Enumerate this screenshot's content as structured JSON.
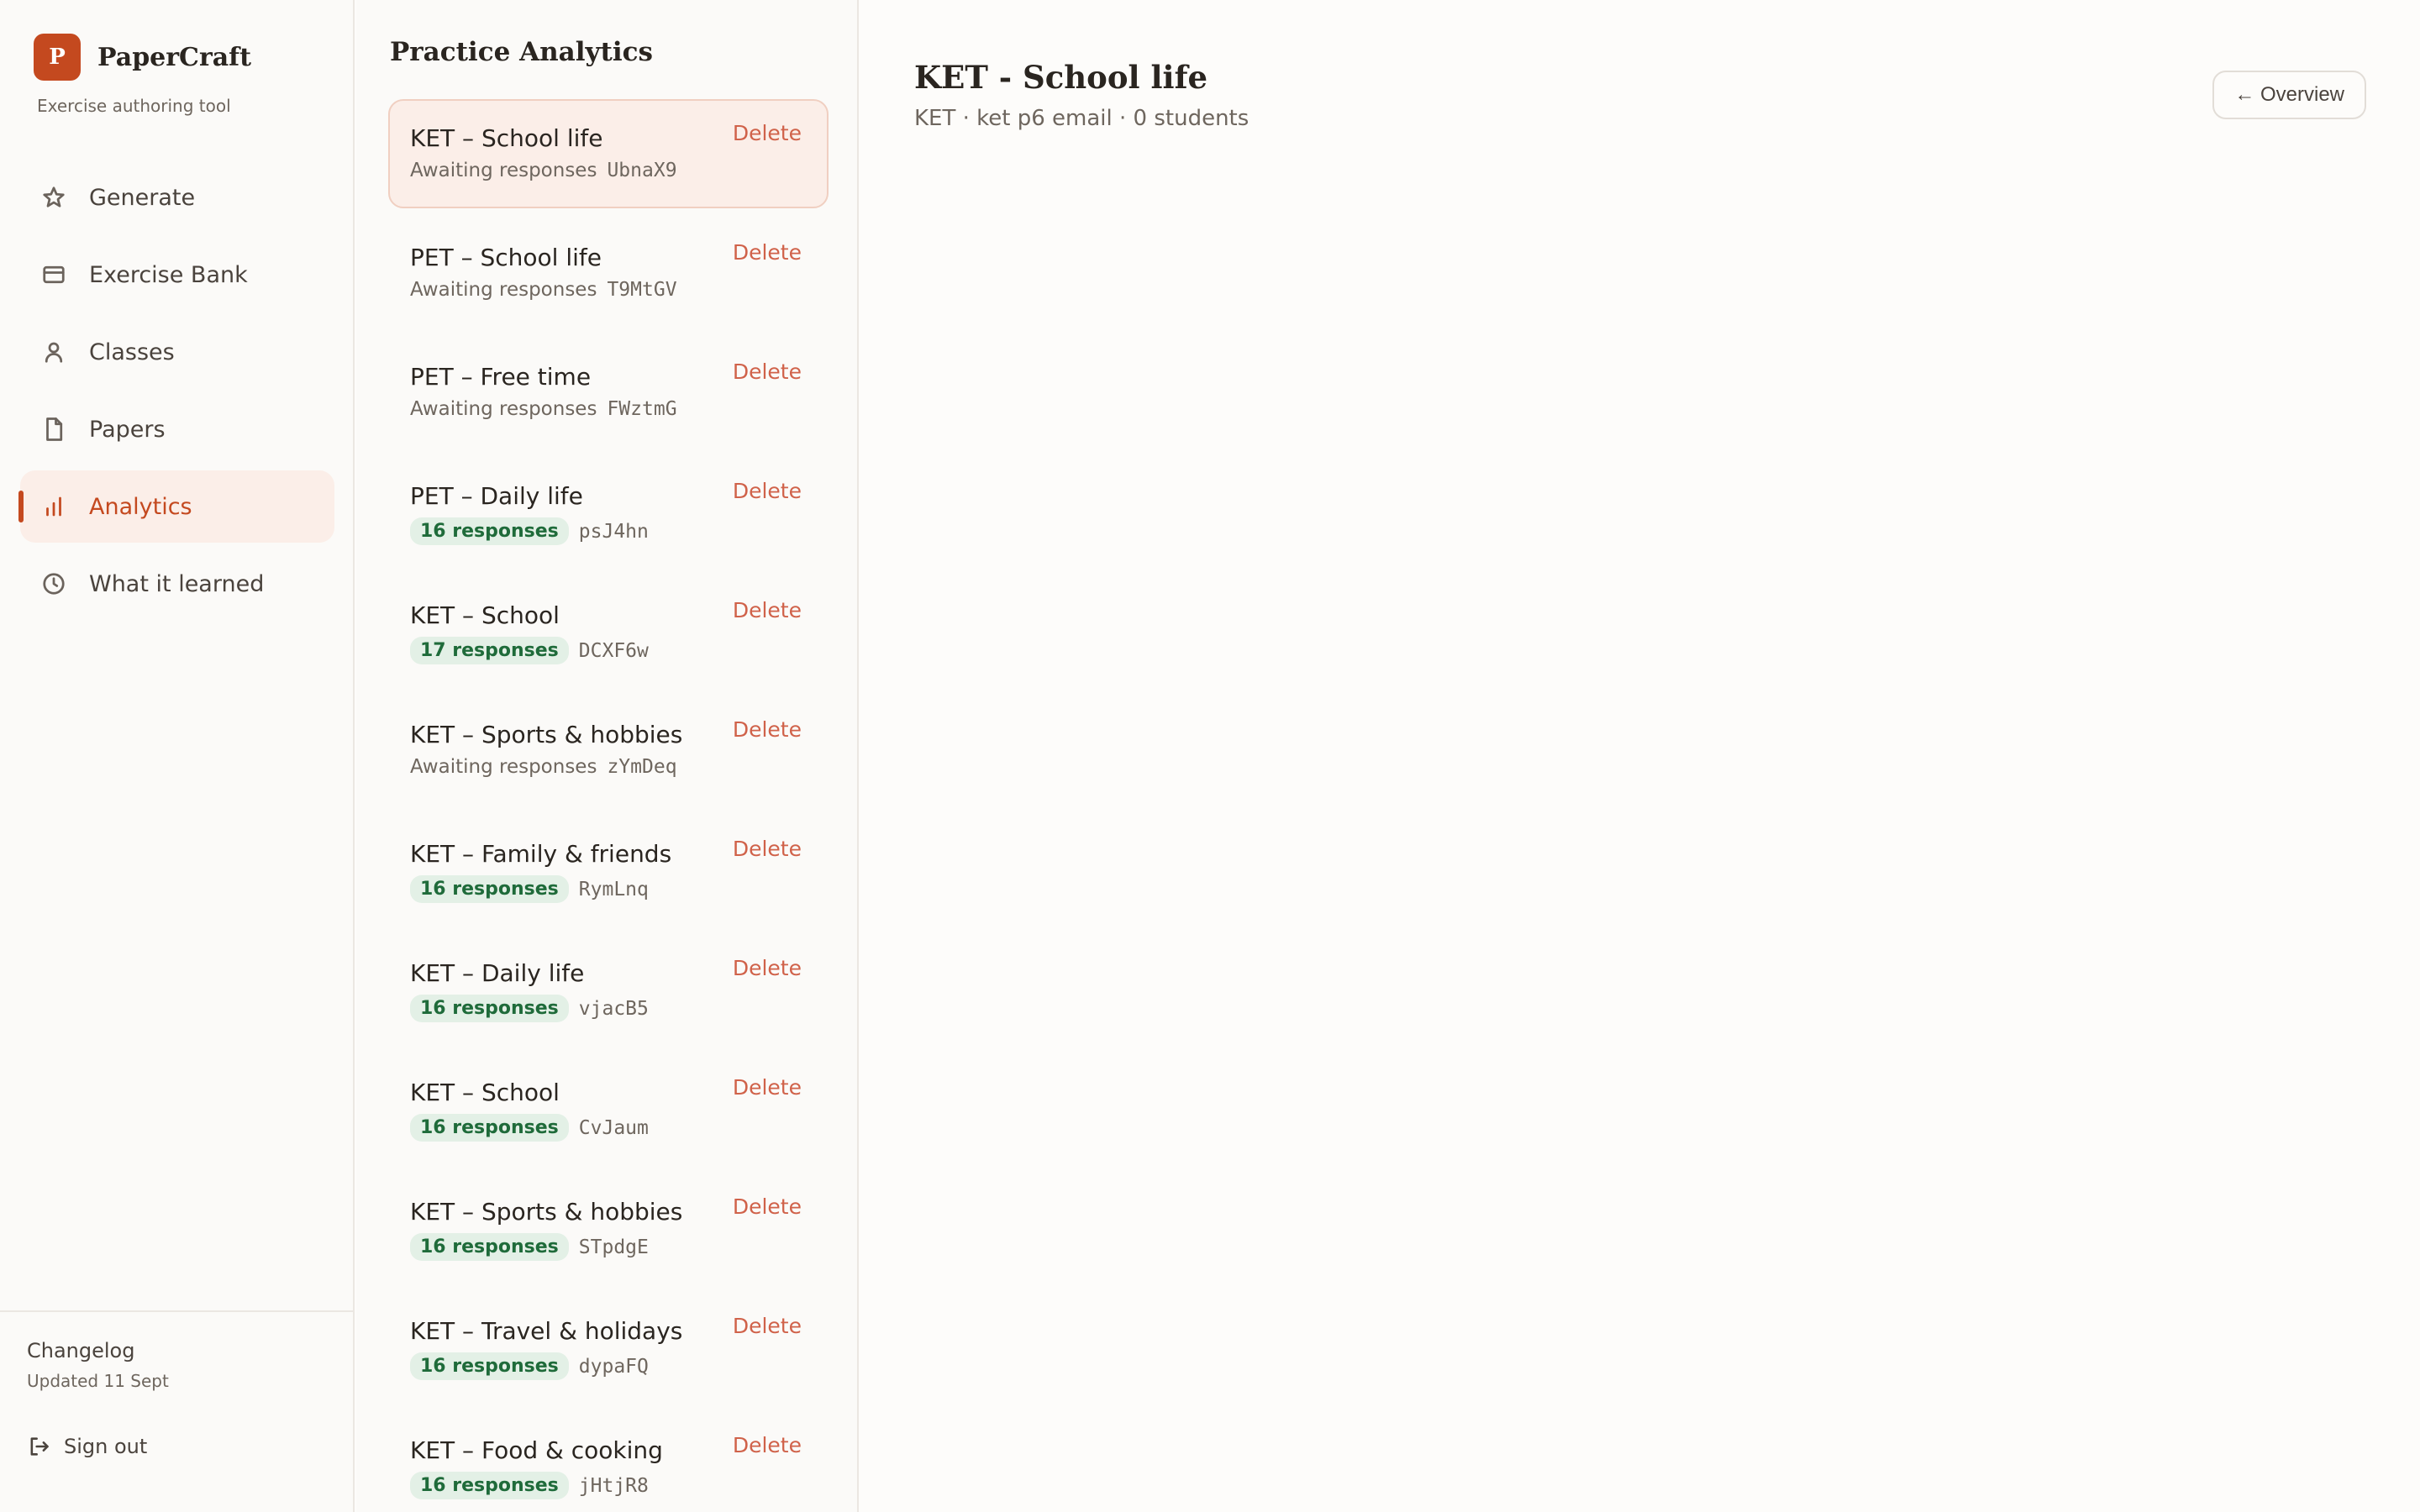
{
  "brand": {
    "logo_letter": "P",
    "name": "PaperCraft",
    "subtitle": "Exercise authoring tool"
  },
  "nav": [
    {
      "label": "Generate",
      "icon": "star-icon"
    },
    {
      "label": "Exercise Bank",
      "icon": "card-icon"
    },
    {
      "label": "Classes",
      "icon": "person-icon"
    },
    {
      "label": "Papers",
      "icon": "document-icon"
    },
    {
      "label": "Analytics",
      "icon": "bar-chart-icon",
      "active": true
    },
    {
      "label": "What it learned",
      "icon": "clock-icon"
    }
  ],
  "footer": {
    "changelog_title": "Changelog",
    "changelog_updated": "Updated 11 Sept",
    "signout_label": "Sign out"
  },
  "list": {
    "title": "Practice Analytics",
    "delete_label": "Delete",
    "items": [
      {
        "title": "KET – School life",
        "status": "Awaiting responses",
        "code": "UbnaX9",
        "selected": true
      },
      {
        "title": "PET – School life",
        "status": "Awaiting responses",
        "code": "T9MtGV"
      },
      {
        "title": "PET – Free time",
        "status": "Awaiting responses",
        "code": "FWztmG"
      },
      {
        "title": "PET – Daily life",
        "responses": "16 responses",
        "code": "psJ4hn"
      },
      {
        "title": "KET – School",
        "responses": "17 responses",
        "code": "DCXF6w"
      },
      {
        "title": "KET – Sports & hobbies",
        "status": "Awaiting responses",
        "code": "zYmDeq"
      },
      {
        "title": "KET – Family & friends",
        "responses": "16 responses",
        "code": "RymLnq"
      },
      {
        "title": "KET – Daily life",
        "responses": "16 responses",
        "code": "vjacB5"
      },
      {
        "title": "KET – School",
        "responses": "16 responses",
        "code": "CvJaum"
      },
      {
        "title": "KET – Sports & hobbies",
        "responses": "16 responses",
        "code": "STpdgE"
      },
      {
        "title": "KET – Travel & holidays",
        "responses": "16 responses",
        "code": "dypaFQ"
      },
      {
        "title": "KET – Food & cooking",
        "responses": "16 responses",
        "code": "jHtjR8"
      }
    ]
  },
  "detail": {
    "title": "KET - School life",
    "subtitle": "KET · ket p6 email · 0 students",
    "overview_button": "← Overview"
  },
  "colors": {
    "accent": "#c4491f",
    "accent_bg": "#fbeee8",
    "badge_bg": "#e3f0e6",
    "badge_text": "#1f6b3a",
    "delete": "#d0624a"
  }
}
